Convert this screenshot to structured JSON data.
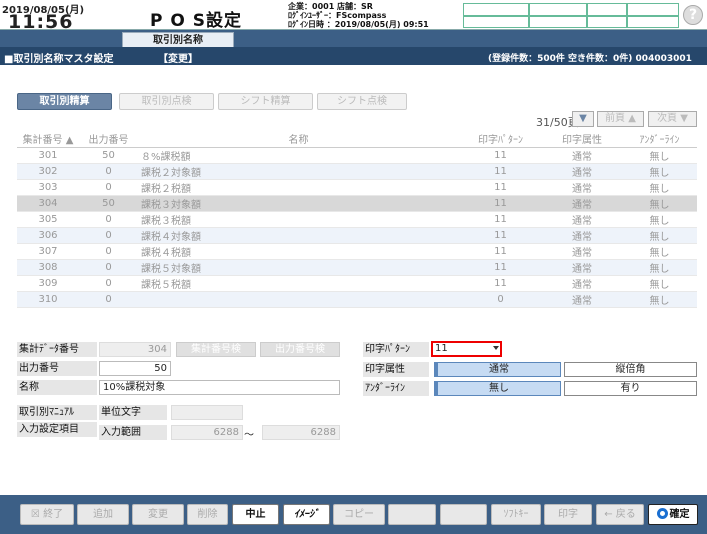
{
  "header": {
    "date": "2019/08/05(月)",
    "time": "11:56",
    "title": "P O S設定",
    "company": "企業：0001 店舗：SR",
    "login_user": "ﾛｸﾞｲﾝﾕｰｻﾞｰ：FScompass",
    "login_date": "ﾛｸﾞｲﾝ日時 ：2019/08/05(月) 09:51",
    "help_icon": "?"
  },
  "tab": {
    "label": "取引別名称"
  },
  "section": {
    "title": "■取引別名称マスタ設定",
    "mode": "【変更】",
    "count_info": "(登録件数：500件 空き件数：0件) 004003001"
  },
  "top_buttons": [
    "取引別精算",
    "取引別点検",
    "シフト精算",
    "シフト点検"
  ],
  "paging": {
    "page": "31/50頁",
    "prev": "前頁 ▲",
    "next": "次頁 ▼"
  },
  "table": {
    "headers": [
      "集計番号 ▲",
      "出力番号",
      "名称",
      "印字ﾊﾟﾀｰﾝ",
      "印字属性",
      "ｱﾝﾀﾞｰﾗｲﾝ"
    ],
    "rows": [
      [
        "301",
        "50",
        "８%課税額",
        "11",
        "通常",
        "無し"
      ],
      [
        "302",
        "0",
        "課税２対象額",
        "11",
        "通常",
        "無し"
      ],
      [
        "303",
        "0",
        "課税２税額",
        "11",
        "通常",
        "無し"
      ],
      [
        "304",
        "50",
        "課税３対象額",
        "11",
        "通常",
        "無し"
      ],
      [
        "305",
        "0",
        "課税３税額",
        "11",
        "通常",
        "無し"
      ],
      [
        "306",
        "0",
        "課税４対象額",
        "11",
        "通常",
        "無し"
      ],
      [
        "307",
        "0",
        "課税４税額",
        "11",
        "通常",
        "無し"
      ],
      [
        "308",
        "0",
        "課税５対象額",
        "11",
        "通常",
        "無し"
      ],
      [
        "309",
        "0",
        "課税５税額",
        "11",
        "通常",
        "無し"
      ],
      [
        "310",
        "0",
        "",
        "0",
        "通常",
        "無し"
      ]
    ],
    "selected_index": 3
  },
  "form": {
    "data_no_label": "集計ﾃﾞｰﾀ番号",
    "data_no": "304",
    "btn_shukei": "集計番号検",
    "btn_output": "出力番号検",
    "out_no_label": "出力番号",
    "out_no": "50",
    "name_label": "名称",
    "name": "10%課税対象",
    "manual_label": "取引別ﾏﾆｭｱﾙ",
    "input_label": "入力設定項目",
    "unit_label": "単位文字",
    "unit": "",
    "range_label": "入力範囲",
    "range_from": "6288",
    "range_sep": "～",
    "range_to": "6288",
    "print_pattern_label": "印字ﾊﾟﾀｰﾝ",
    "print_pattern": "11",
    "print_attr_label": "印字属性",
    "attr_normal": "通常",
    "attr_double": "縦倍角",
    "underline_label": "ｱﾝﾀﾞｰﾗｲﾝ",
    "ul_none": "無し",
    "ul_yes": "有り"
  },
  "footer": {
    "end": "終了",
    "add": "追加",
    "change": "変更",
    "delete": "削除",
    "cancel": "中止",
    "image": "ｲﾒｰｼﾞ",
    "copy": "コピー",
    "softkey": "ｿﾌﾄｷｰ",
    "print": "印字",
    "back": "戻る",
    "confirm": "確定"
  },
  "colors": {
    "header_bar": "#3c5f86",
    "section_bar": "#26476b",
    "highlight": "#e00000",
    "selected_option": "#c6dbf3"
  }
}
